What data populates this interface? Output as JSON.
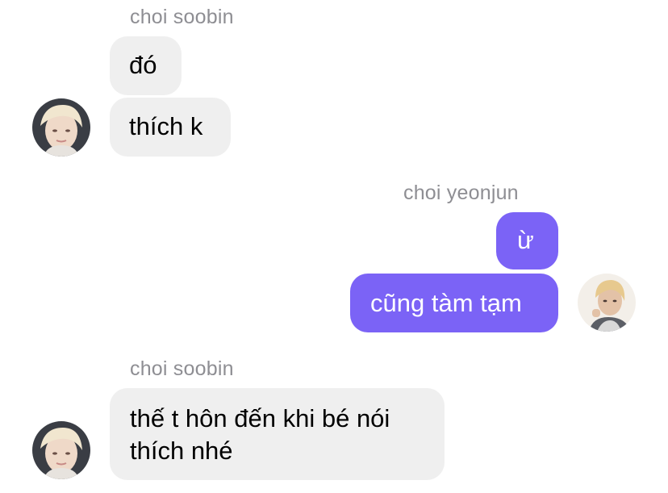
{
  "colors": {
    "incoming_bubble": "#efefef",
    "outgoing_bubble": "#7b63f6",
    "sender_name": "#8e8e93"
  },
  "groups": [
    {
      "sender": "choi soobin",
      "direction": "incoming",
      "avatar_icon": "soobin-avatar-icon",
      "messages": [
        "đó",
        "thích k"
      ]
    },
    {
      "sender": "choi yeonjun",
      "direction": "outgoing",
      "avatar_icon": "yeonjun-avatar-icon",
      "messages": [
        "ừ",
        "cũng tàm tạm"
      ]
    },
    {
      "sender": "choi soobin",
      "direction": "incoming",
      "avatar_icon": "soobin-avatar-icon",
      "messages": [
        "thế t hôn đến khi bé nói",
        "thích nhé"
      ]
    }
  ]
}
